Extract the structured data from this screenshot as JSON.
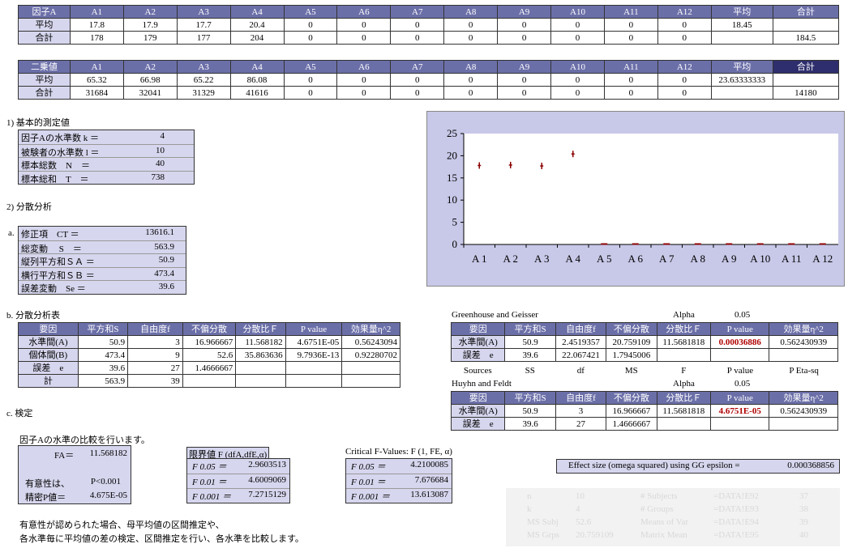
{
  "table1": {
    "headers": [
      "因子A",
      "A1",
      "A2",
      "A3",
      "A4",
      "A5",
      "A6",
      "A7",
      "A8",
      "A9",
      "A10",
      "A11",
      "A12",
      "平均",
      "合計"
    ],
    "rows": [
      [
        "平均",
        "17.8",
        "17.9",
        "17.7",
        "20.4",
        "0",
        "0",
        "0",
        "0",
        "0",
        "0",
        "0",
        "0",
        "18.45",
        ""
      ],
      [
        "合計",
        "178",
        "179",
        "177",
        "204",
        "0",
        "0",
        "0",
        "0",
        "0",
        "0",
        "0",
        "0",
        "",
        "184.5"
      ]
    ]
  },
  "table2": {
    "headers": [
      "二乗値",
      "A1",
      "A2",
      "A3",
      "A4",
      "A5",
      "A6",
      "A7",
      "A8",
      "A9",
      "A10",
      "A11",
      "A12",
      "平均",
      "合計"
    ],
    "rows": [
      [
        "平均",
        "65.32",
        "66.98",
        "65.22",
        "86.08",
        "0",
        "0",
        "0",
        "0",
        "0",
        "0",
        "0",
        "0",
        "23.63333333",
        ""
      ],
      [
        "合計",
        "31684",
        "32041",
        "31329",
        "41616",
        "0",
        "0",
        "0",
        "0",
        "0",
        "0",
        "0",
        "0",
        "",
        "14180"
      ]
    ]
  },
  "section1": {
    "title": "1) 基本的測定値",
    "rows": [
      {
        "label": "因子Aの水準数 k ＝",
        "value": "4"
      },
      {
        "label": "被験者の水準数 l ＝",
        "value": "10"
      },
      {
        "label": "標本総数　N　＝",
        "value": "40"
      },
      {
        "label": "標本総和　T　＝",
        "value": "738"
      }
    ]
  },
  "section2": {
    "title": "2) 分散分析",
    "marker_a": "a.",
    "rows": [
      {
        "label": "修正項　CT ＝",
        "value": "13616.1"
      },
      {
        "label": "総変動　 S　＝",
        "value": "563.9"
      },
      {
        "label": "縦列平方和ＳＡ ＝",
        "value": "50.9"
      },
      {
        "label": "横行平方和ＳＢ ＝",
        "value": "473.4"
      },
      {
        "label": "誤差変動　Se ＝",
        "value": "39.6"
      }
    ]
  },
  "anova": {
    "title": "b. 分散分析表",
    "headers": [
      "要因",
      "平方和S",
      "自由度f",
      "不偏分散",
      "分散比Ｆ",
      "P value",
      "効果量η^2"
    ],
    "rows": [
      [
        "水準間(A)",
        "50.9",
        "3",
        "16.966667",
        "11.568182",
        "4.6751E-05",
        "0.56243094"
      ],
      [
        "個体間(B)",
        "473.4",
        "9",
        "52.6",
        "35.863636",
        "9.7936E-13",
        "0.92280702"
      ],
      [
        "誤差　e",
        "39.6",
        "27",
        "1.4666667",
        "",
        "",
        ""
      ],
      [
        "計",
        "563.9",
        "39",
        "",
        "",
        "",
        ""
      ]
    ]
  },
  "gg": {
    "title": "Greenhouse and Geisser",
    "alpha_label": "Alpha",
    "alpha": "0.05",
    "headers": [
      "要因",
      "平方和S",
      "自由度f",
      "不偏分散",
      "分散比Ｆ",
      "P value",
      "効果量η^2"
    ],
    "rows": [
      [
        "水準間(A)",
        "50.9",
        "2.4519357",
        "20.759109",
        "11.5681818",
        "0.00036886",
        "0.562430939"
      ],
      [
        "誤差　e",
        "39.6",
        "22.067421",
        "1.7945006",
        "",
        "",
        ""
      ]
    ],
    "sources_row": [
      "Sources",
      "SS",
      "df",
      "MS",
      "F",
      "P value",
      "P Eta-sq"
    ]
  },
  "hf": {
    "title": "Huyhn and Feldt",
    "alpha_label": "Alpha",
    "alpha": "0.05",
    "headers": [
      "要因",
      "平方和S",
      "自由度f",
      "不偏分散",
      "分散比Ｆ",
      "P value",
      "効果量η^2"
    ],
    "rows": [
      [
        "水準間(A)",
        "50.9",
        "3",
        "16.966667",
        "11.5681818",
        "4.6751E-05",
        "0.562430939"
      ],
      [
        "誤差　e",
        "39.6",
        "27",
        "1.4666667",
        "",
        "",
        ""
      ]
    ]
  },
  "test": {
    "title": "c. 検定",
    "subtitle": "因子Aの水準の比較を行います。",
    "fa_label": "FA＝",
    "fa_value": "11.568182",
    "sig_label": "有意性は、",
    "sig_value": "P<0.001",
    "p_label": "精密P値＝",
    "p_value": "4.675E-05",
    "crit_title": "限界値 F (dfA,dfE,α)",
    "crit_rows": [
      {
        "label": "F 0.05 ＝",
        "value": "2.9603513"
      },
      {
        "label": "F 0.01 ＝",
        "value": "4.6009069"
      },
      {
        "label": "F 0.001 ＝",
        "value": "7.2715129"
      }
    ],
    "crit2_title": "Critical F-Values: F (1, FE, α)",
    "crit2_rows": [
      {
        "label": "F 0.05 ＝",
        "value": "4.2100085"
      },
      {
        "label": "F 0.01 ＝",
        "value": "7.676684"
      },
      {
        "label": "F 0.001 ＝",
        "value": "13.613087"
      }
    ],
    "note1": "有意性が認められた場合、母平均値の区間推定や、",
    "note2": "各水準毎に平均値の差の検定、区間推定を行い、各水準を比較します。"
  },
  "omega": {
    "label": "Effect size (omega squared) using GG epsilon =",
    "value": "0.000368856"
  },
  "ghost": {
    "rows": [
      [
        "n",
        "10",
        "# Subjects",
        "=DATA!E92",
        "37"
      ],
      [
        "k",
        "4",
        "# Groups",
        "=DATA!E93",
        "38"
      ],
      [
        "MS Subj",
        "52.6",
        "Means of Var",
        "=DATA!E94",
        "39"
      ],
      [
        "MS Grps",
        "20.759109",
        "Matrix Mean",
        "=DATA!E95",
        "40"
      ]
    ]
  },
  "colors": {
    "header": "#6b6fa8",
    "header_dark": "#2e2e6e",
    "row_label": "#d6d6ee",
    "chart_bg": "#c8c8e8",
    "marker": "#8b0000",
    "highlight": "#b00000"
  },
  "chart_data": {
    "type": "scatter",
    "categories": [
      "A 1",
      "A 2",
      "A 3",
      "A 4",
      "A 5",
      "A 6",
      "A 7",
      "A 8",
      "A 9",
      "A 10",
      "A 11",
      "A 12"
    ],
    "values": [
      17.8,
      17.9,
      17.7,
      20.4,
      0,
      0,
      0,
      0,
      0,
      0,
      0,
      0
    ],
    "ylim": [
      0,
      25
    ],
    "yticks": [
      0,
      5,
      10,
      15,
      20,
      25
    ],
    "title": "",
    "xlabel": "",
    "ylabel": "",
    "grid": false,
    "legend": "none"
  }
}
